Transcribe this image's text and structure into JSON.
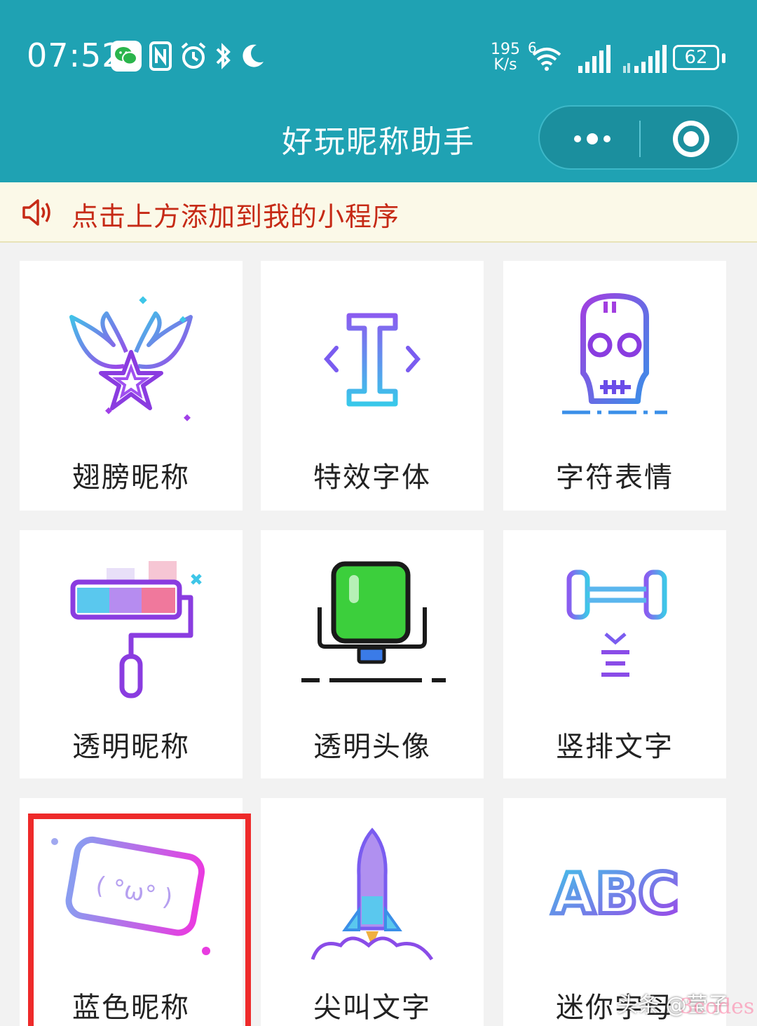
{
  "status_bar": {
    "time": "07:52",
    "net_speed_value": "195",
    "net_speed_unit": "K/s",
    "wifi_tag": "6",
    "battery": "62",
    "icons": [
      "wechat-icon",
      "nfc-icon",
      "alarm-icon",
      "bluetooth-icon",
      "moon-icon",
      "wifi-icon",
      "signal-icon",
      "signal-icon"
    ]
  },
  "header": {
    "title": "好玩昵称助手",
    "more_button": "more-icon",
    "close_button": "target-icon"
  },
  "notice": {
    "icon": "speaker-icon",
    "text": "点击上方添加到我的小程序"
  },
  "grid": {
    "items": [
      {
        "label": "翅膀昵称",
        "icon": "winged-star-icon"
      },
      {
        "label": "特效字体",
        "icon": "text-cursor-icon"
      },
      {
        "label": "字符表情",
        "icon": "skull-icon"
      },
      {
        "label": "透明昵称",
        "icon": "paint-roller-icon"
      },
      {
        "label": "透明头像",
        "icon": "green-square-icon"
      },
      {
        "label": "竖排文字",
        "icon": "vertical-text-icon"
      },
      {
        "label": "蓝色昵称",
        "icon": "kaomoji-icon",
        "highlighted": true
      },
      {
        "label": "尖叫文字",
        "icon": "rocket-icon"
      },
      {
        "label": "迷你字母",
        "icon": "abc-icon"
      }
    ]
  },
  "kaomoji": "( °ω° )",
  "abc_text": "ABC",
  "watermark": {
    "author": "头条 @莹子",
    "site": "3codes"
  },
  "colors": {
    "header": "#1fa2b3",
    "notice_bg": "#fbf9e8",
    "notice_text": "#c62a16",
    "highlight_border": "#ee2a2a"
  }
}
